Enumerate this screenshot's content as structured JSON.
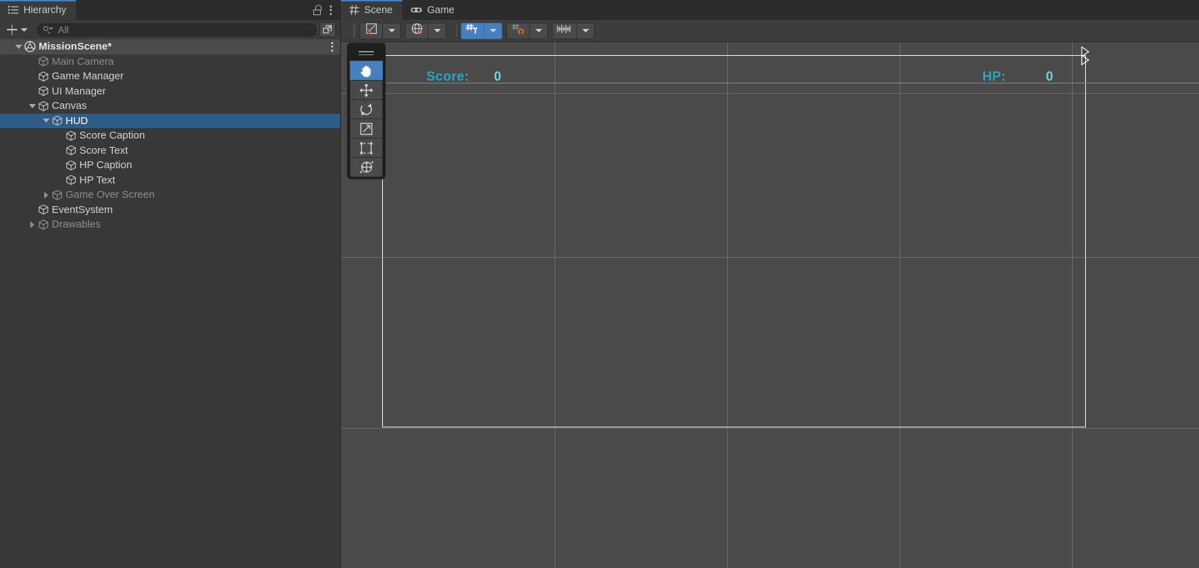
{
  "hierarchy_panel": {
    "tab_label": "Hierarchy",
    "tab_icon": "hierarchy-list-icon",
    "lock_icon": "lock-open-icon",
    "menu_icon": "kebab-menu-icon",
    "toolbar": {
      "add_label": "+",
      "add_icon": "plus-icon",
      "add_dropdown_icon": "chevron-down-icon",
      "search_icon": "search-icon",
      "search_value": "",
      "search_placeholder": "All",
      "expand_icon": "open-in-new-window-icon"
    },
    "tree": [
      {
        "label": "MissionScene*",
        "depth": 0,
        "icon": "unity-scene-icon",
        "expander": "down",
        "state": "scene",
        "kebab": true
      },
      {
        "label": "Main Camera",
        "depth": 1,
        "icon": "gameobject-cube-icon",
        "expander": "none",
        "state": "dim"
      },
      {
        "label": "Game Manager",
        "depth": 1,
        "icon": "gameobject-cube-icon",
        "expander": "none",
        "state": "normal"
      },
      {
        "label": "UI Manager",
        "depth": 1,
        "icon": "gameobject-cube-icon",
        "expander": "none",
        "state": "normal"
      },
      {
        "label": "Canvas",
        "depth": 1,
        "icon": "gameobject-cube-icon",
        "expander": "down",
        "state": "normal"
      },
      {
        "label": "HUD",
        "depth": 2,
        "icon": "gameobject-cube-icon",
        "expander": "down",
        "state": "selected"
      },
      {
        "label": "Score Caption",
        "depth": 3,
        "icon": "gameobject-cube-icon",
        "expander": "none",
        "state": "normal"
      },
      {
        "label": "Score Text",
        "depth": 3,
        "icon": "gameobject-cube-icon",
        "expander": "none",
        "state": "normal"
      },
      {
        "label": "HP Caption",
        "depth": 3,
        "icon": "gameobject-cube-icon",
        "expander": "none",
        "state": "normal"
      },
      {
        "label": "HP Text",
        "depth": 3,
        "icon": "gameobject-cube-icon",
        "expander": "none",
        "state": "normal"
      },
      {
        "label": "Game Over Screen",
        "depth": 2,
        "icon": "gameobject-cube-icon",
        "expander": "right",
        "state": "dim"
      },
      {
        "label": "EventSystem",
        "depth": 1,
        "icon": "gameobject-cube-icon",
        "expander": "none",
        "state": "normal"
      },
      {
        "label": "Drawables",
        "depth": 1,
        "icon": "gameobject-cube-icon",
        "expander": "right",
        "state": "dim"
      }
    ]
  },
  "scene_panel": {
    "tabs": [
      {
        "label": "Scene",
        "icon": "scene-grid-icon",
        "active": true
      },
      {
        "label": "Game",
        "icon": "gamepad-icon",
        "active": false
      }
    ],
    "toolbar": {
      "pivot_icon": "pivot-center-icon",
      "pivot_dropdown_icon": "chevron-down-icon",
      "handle_space_icon": "global-space-globe-icon",
      "handle_space_dropdown_icon": "chevron-down-icon",
      "grid_visibility_icon": "grid-axis-y-icon",
      "grid_visibility_dropdown_icon": "chevron-down-icon",
      "grid_snap_icon": "grid-snap-magnet-icon",
      "grid_snap_dropdown_icon": "chevron-down-icon",
      "scene_view_scale_icon": "ruler-scale-icon",
      "scene_view_scale_dropdown_icon": "chevron-down-icon"
    },
    "tool_palette": {
      "grip_icon": "drag-handle-icon",
      "tools": [
        {
          "name": "hand-tool",
          "icon": "hand-icon",
          "active": true
        },
        {
          "name": "move-tool",
          "icon": "move-arrows-icon",
          "active": false
        },
        {
          "name": "rotate-tool",
          "icon": "rotate-icon",
          "active": false
        },
        {
          "name": "scale-tool",
          "icon": "scale-icon",
          "active": false
        },
        {
          "name": "rect-transform-tool",
          "icon": "rect-transform-icon",
          "active": false
        },
        {
          "name": "transform-tool",
          "icon": "transform-icon",
          "active": false
        }
      ]
    },
    "hud_overlay": {
      "score_caption": "Score:",
      "score_value": "0",
      "hp_caption": "HP:",
      "hp_value": "0",
      "caption_color": "#2aa5bd",
      "value_color": "#6ecede"
    }
  },
  "colors": {
    "panel_bg": "#383838",
    "tabbar_bg": "#2c2c2c",
    "toolbar_bg": "#3c3c3c",
    "scene_bg": "#4a4a4a",
    "selection_blue": "#2c5c87",
    "accent_blue": "#4a7fbd",
    "grid_line": "#6e6e6e",
    "canvas_outline": "#ffffff"
  }
}
